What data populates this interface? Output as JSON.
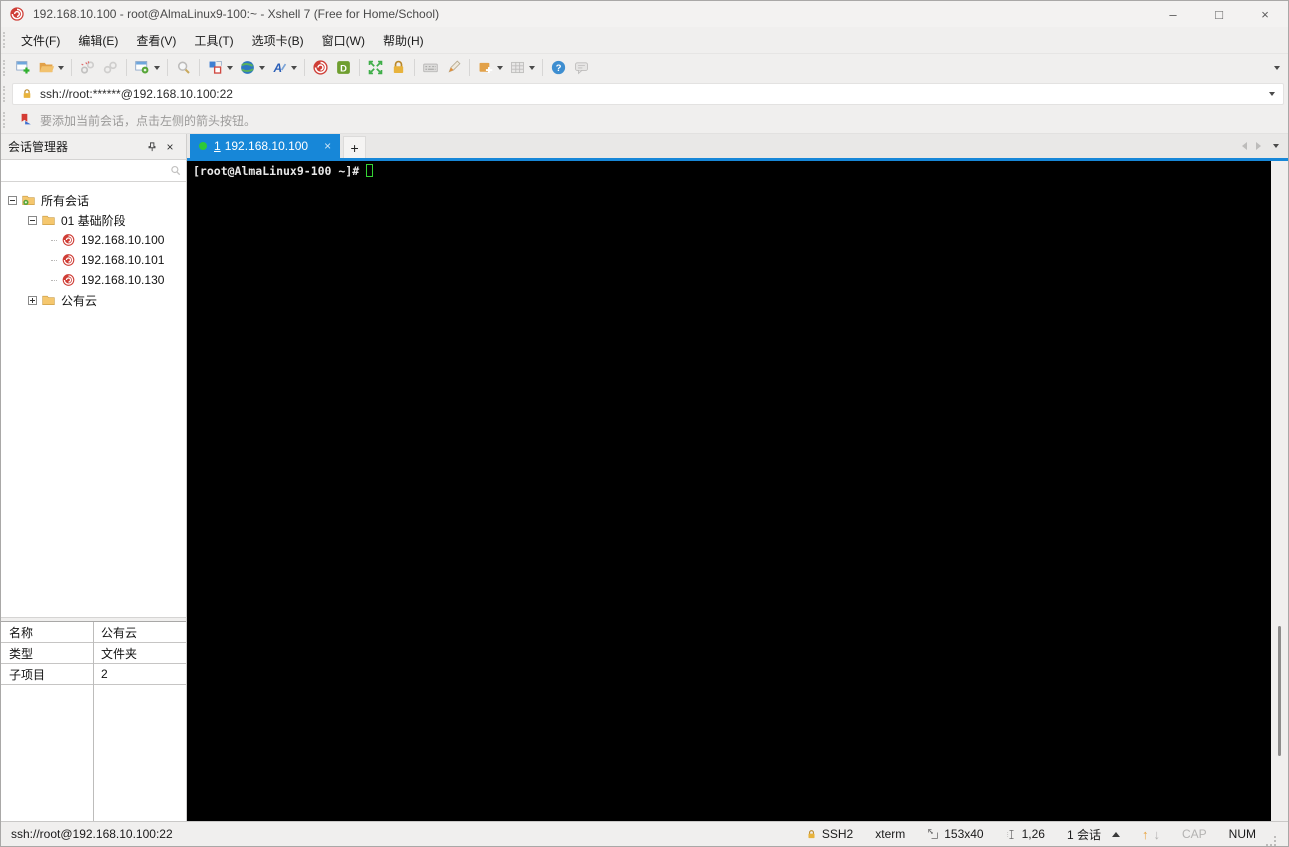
{
  "window": {
    "title": "192.168.10.100 - root@AlmaLinux9-100:~ - Xshell 7 (Free for Home/School)",
    "controls": {
      "minimize": "–",
      "maximize": "□",
      "close": "×"
    }
  },
  "menu": {
    "items": [
      {
        "label": "文件(F)"
      },
      {
        "label": "编辑(E)"
      },
      {
        "label": "查看(V)"
      },
      {
        "label": "工具(T)"
      },
      {
        "label": "选项卡(B)"
      },
      {
        "label": "窗口(W)"
      },
      {
        "label": "帮助(H)"
      }
    ]
  },
  "toolbar": {
    "buttons": [
      "new-session",
      "open-folder",
      "disconnect",
      "reconnect",
      "session-properties",
      "find",
      "layout",
      "web",
      "font",
      "xshell",
      "xftp",
      "fullscreen",
      "lock",
      "soft-keyboard",
      "highlighter",
      "new-file",
      "tile-grid",
      "help",
      "feedback"
    ]
  },
  "address_bar": {
    "value": "ssh://root:******@192.168.10.100:22"
  },
  "info_bar": {
    "text": "要添加当前会话，点击左侧的箭头按钮。"
  },
  "session_manager": {
    "title": "会话管理器",
    "search_value": "",
    "tree": [
      {
        "label": "所有会话",
        "level": 0,
        "icon": "folder-gear",
        "state": "expanded"
      },
      {
        "label": "01 基础阶段",
        "level": 1,
        "icon": "folder",
        "state": "expanded"
      },
      {
        "label": "192.168.10.100",
        "level": 2,
        "icon": "session"
      },
      {
        "label": "192.168.10.101",
        "level": 2,
        "icon": "session"
      },
      {
        "label": "192.168.10.130",
        "level": 2,
        "icon": "session"
      },
      {
        "label": "公有云",
        "level": 1,
        "icon": "folder",
        "state": "collapsed"
      }
    ],
    "properties": [
      {
        "key": "名称",
        "value": "公有云"
      },
      {
        "key": "类型",
        "value": "文件夹"
      },
      {
        "key": "子项目",
        "value": "2"
      }
    ]
  },
  "tabs": {
    "active": {
      "index": "1",
      "label": "192.168.10.100",
      "close": "×",
      "connected": true
    },
    "new_tab": "+"
  },
  "terminal": {
    "prompt": "[root@AlmaLinux9-100 ~]#"
  },
  "status_bar": {
    "url": "ssh://root@192.168.10.100:22",
    "protocol": "SSH2",
    "term_type": "xterm",
    "size": "153x40",
    "cursor_pos": "1,26",
    "sessions": "1 会话",
    "cap": "CAP",
    "num": "NUM"
  },
  "colors": {
    "accent_blue": "#1787d8",
    "connected_green": "#2dc937",
    "terminal_cursor_green": "#35d435",
    "xshell_red": "#cf3e36"
  }
}
